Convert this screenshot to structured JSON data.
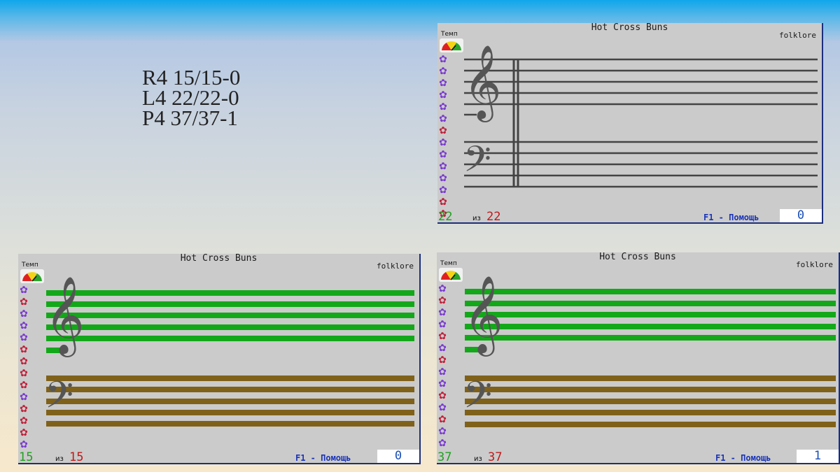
{
  "results": [
    "R4 15/15-0",
    "L4 22/22-0",
    "P4 37/37-1"
  ],
  "panels": {
    "top_right": {
      "title": "Hot Cross Buns",
      "genre": "folklore",
      "tempo_label": "Темп",
      "current": "22",
      "of_label": "из",
      "total": "22",
      "help": "F1 - Помощь",
      "score": "0"
    },
    "bottom_left": {
      "title": "Hot Cross Buns",
      "genre": "folklore",
      "tempo_label": "Темп",
      "current": "15",
      "of_label": "из",
      "total": "15",
      "help": "F1 - Помощь",
      "score": "0"
    },
    "bottom_right": {
      "title": "Hot Cross Buns",
      "genre": "folklore",
      "tempo_label": "Темп",
      "current": "37",
      "of_label": "из",
      "total": "37",
      "help": "F1 - Помощь",
      "score": "1"
    }
  },
  "colors": {
    "treble_active": "#13a81a",
    "bass_active": "#80611a",
    "staff_idle": "#444444",
    "star_purple": "#7a3ad0",
    "star_red": "#c0203a"
  },
  "icons": [
    "tempo-gauge-icon",
    "flower-icon",
    "treble-clef-icon",
    "bass-clef-icon"
  ]
}
